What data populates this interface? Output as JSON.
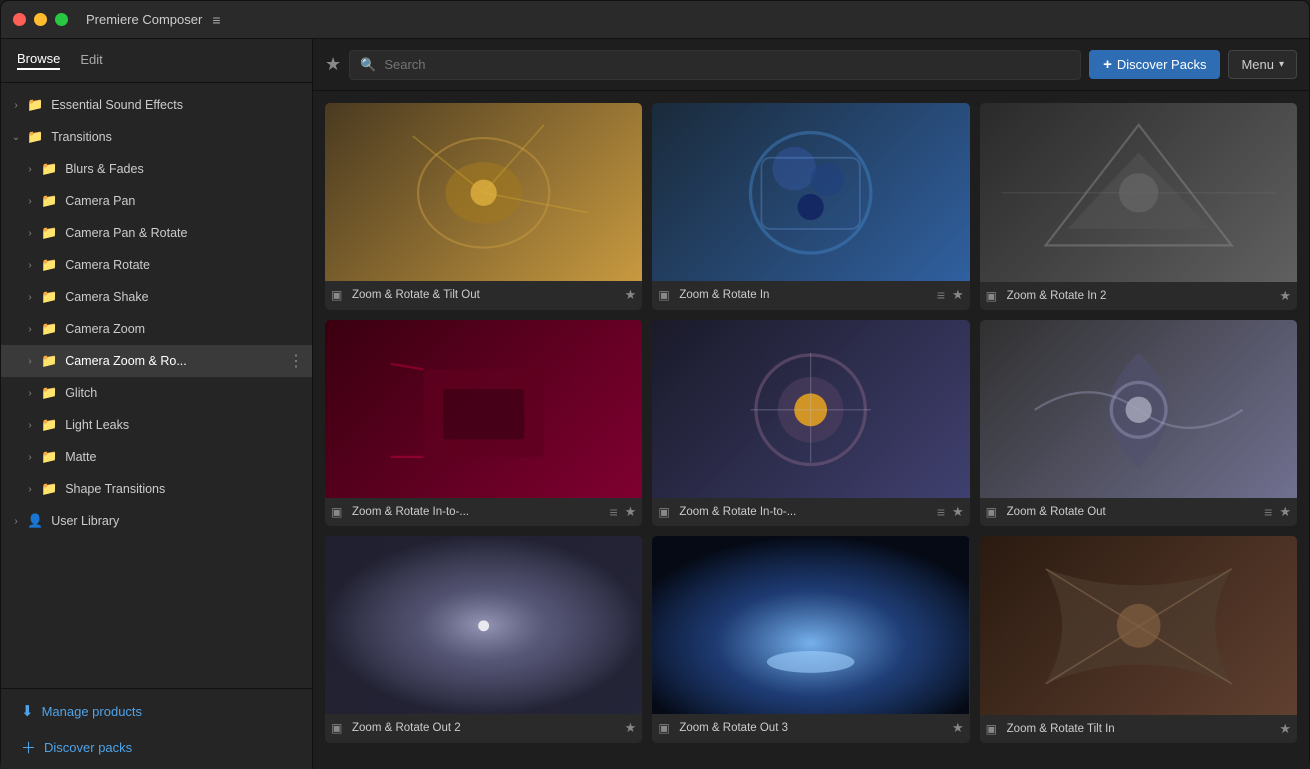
{
  "app": {
    "title": "Premiere Composer",
    "hamburger": "≡"
  },
  "tabs": [
    {
      "id": "browse",
      "label": "Browse",
      "active": true
    },
    {
      "id": "edit",
      "label": "Edit",
      "active": false
    }
  ],
  "header": {
    "search_placeholder": "Search",
    "discover_btn": "+ Discover Packs",
    "menu_btn": "Menu"
  },
  "sidebar": {
    "items": [
      {
        "id": "essential-sound",
        "label": "Essential Sound Effects",
        "indent": 1,
        "expanded": false,
        "type": "folder"
      },
      {
        "id": "transitions",
        "label": "Transitions",
        "indent": 1,
        "expanded": true,
        "type": "folder"
      },
      {
        "id": "blurs-fades",
        "label": "Blurs & Fades",
        "indent": 2,
        "expanded": false,
        "type": "folder"
      },
      {
        "id": "camera-pan",
        "label": "Camera Pan",
        "indent": 2,
        "expanded": false,
        "type": "folder"
      },
      {
        "id": "camera-pan-rotate",
        "label": "Camera Pan & Rotate",
        "indent": 2,
        "expanded": false,
        "type": "folder"
      },
      {
        "id": "camera-rotate",
        "label": "Camera Rotate",
        "indent": 2,
        "expanded": false,
        "type": "folder"
      },
      {
        "id": "camera-shake",
        "label": "Camera Shake",
        "indent": 2,
        "expanded": false,
        "type": "folder"
      },
      {
        "id": "camera-zoom",
        "label": "Camera Zoom",
        "indent": 2,
        "expanded": false,
        "type": "folder"
      },
      {
        "id": "camera-zoom-ro",
        "label": "Camera Zoom & Ro...",
        "indent": 2,
        "expanded": false,
        "type": "folder",
        "active": true,
        "dots": true
      },
      {
        "id": "glitch",
        "label": "Glitch",
        "indent": 2,
        "expanded": false,
        "type": "folder"
      },
      {
        "id": "light-leaks",
        "label": "Light Leaks",
        "indent": 2,
        "expanded": false,
        "type": "folder"
      },
      {
        "id": "matte",
        "label": "Matte",
        "indent": 2,
        "expanded": false,
        "type": "folder"
      },
      {
        "id": "shape-transitions",
        "label": "Shape Transitions",
        "indent": 2,
        "expanded": false,
        "type": "folder"
      },
      {
        "id": "user-library",
        "label": "User Library",
        "indent": 1,
        "expanded": false,
        "type": "user"
      }
    ],
    "manage_products": "Manage products",
    "discover_packs": "Discover packs"
  },
  "grid": {
    "items": [
      {
        "id": 1,
        "title": "Zoom & Rotate & Tilt Out",
        "thumb_class": "thumb-1",
        "starred": false
      },
      {
        "id": 2,
        "title": "Zoom & Rotate In",
        "thumb_class": "thumb-2",
        "starred": false
      },
      {
        "id": 3,
        "title": "Zoom & Rotate In 2",
        "thumb_class": "thumb-3",
        "starred": false
      },
      {
        "id": 4,
        "title": "Zoom & Rotate In-to-...",
        "thumb_class": "thumb-4",
        "starred": false
      },
      {
        "id": 5,
        "title": "Zoom & Rotate In-to-...",
        "thumb_class": "thumb-5",
        "starred": false
      },
      {
        "id": 6,
        "title": "Zoom & Rotate Out",
        "thumb_class": "thumb-6",
        "starred": false
      },
      {
        "id": 7,
        "title": "Zoom & Rotate Out 2",
        "thumb_class": "thumb-7",
        "starred": false
      },
      {
        "id": 8,
        "title": "Zoom & Rotate Out 3",
        "thumb_class": "thumb-8",
        "starred": false
      },
      {
        "id": 9,
        "title": "Zoom & Rotate Tilt In",
        "thumb_class": "thumb-9",
        "starred": false
      }
    ]
  }
}
